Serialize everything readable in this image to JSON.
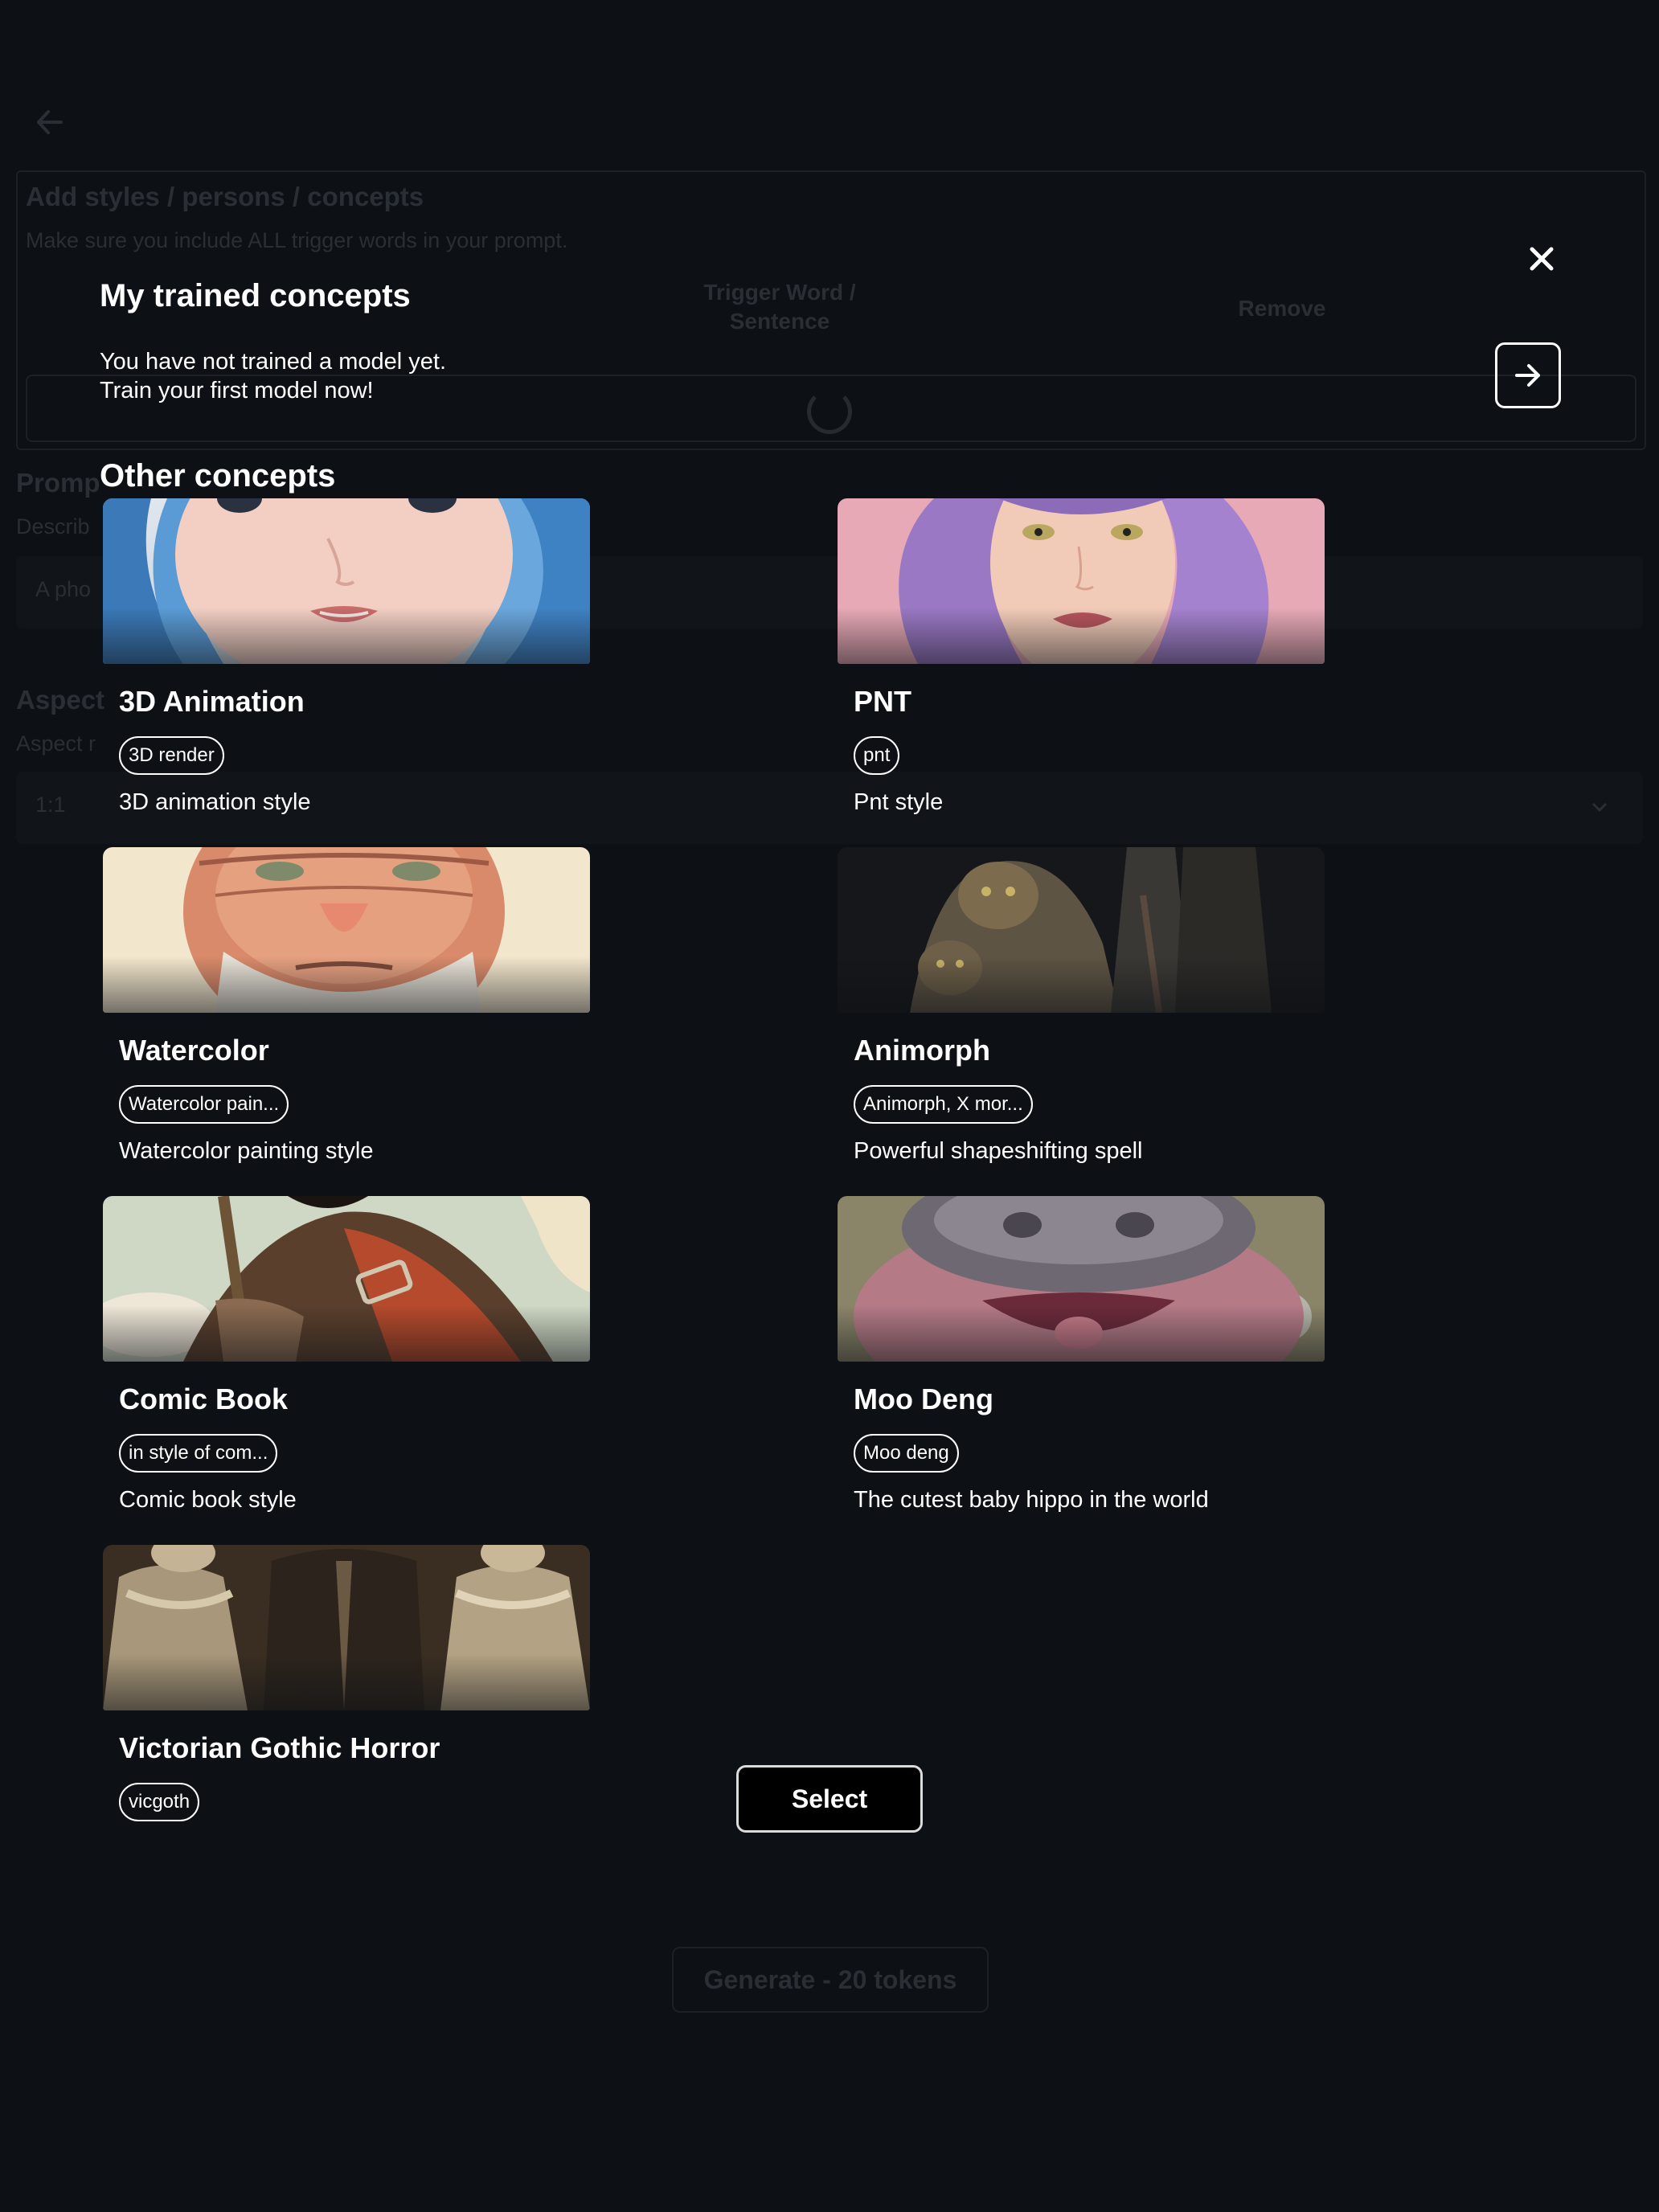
{
  "background_page": {
    "panel_title": "Add styles / persons / concepts",
    "panel_subtitle": "Make sure you include ALL trigger words in your prompt.",
    "col_trigger": "Trigger Word / Sentence",
    "col_remove": "Remove",
    "prompt_label": "Promp",
    "prompt_desc": "Describ",
    "prompt_placeholder": "A pho",
    "aspect_label": "Aspect",
    "aspect_desc": "Aspect r",
    "aspect_value": "1:1",
    "generate_label": "Generate - 20 tokens"
  },
  "modal": {
    "my_concepts_title": "My trained concepts",
    "no_model_line1": "You have not trained a model yet.",
    "no_model_line2": "Train your first model now!",
    "other_concepts_title": "Other concepts",
    "select_label": "Select",
    "concepts": [
      {
        "name": "3D Animation",
        "trigger": "3D render",
        "description": "3D animation style"
      },
      {
        "name": "PNT",
        "trigger": "pnt",
        "description": "Pnt style"
      },
      {
        "name": "Watercolor",
        "trigger": "Watercolor pain...",
        "description": "Watercolor painting style"
      },
      {
        "name": "Animorph",
        "trigger": "Animorph, X mor...",
        "description": "Powerful shapeshifting spell"
      },
      {
        "name": "Comic Book",
        "trigger": "in style of com...",
        "description": "Comic book style"
      },
      {
        "name": "Moo Deng",
        "trigger": "Moo deng",
        "description": "The cutest baby hippo in the world"
      },
      {
        "name": "Victorian Gothic Horror",
        "trigger": "vicgoth",
        "description": ""
      }
    ]
  },
  "icons": {
    "back": "arrow-left-icon",
    "close": "close-icon",
    "next": "arrow-right-icon",
    "chevron": "chevron-down-icon"
  }
}
